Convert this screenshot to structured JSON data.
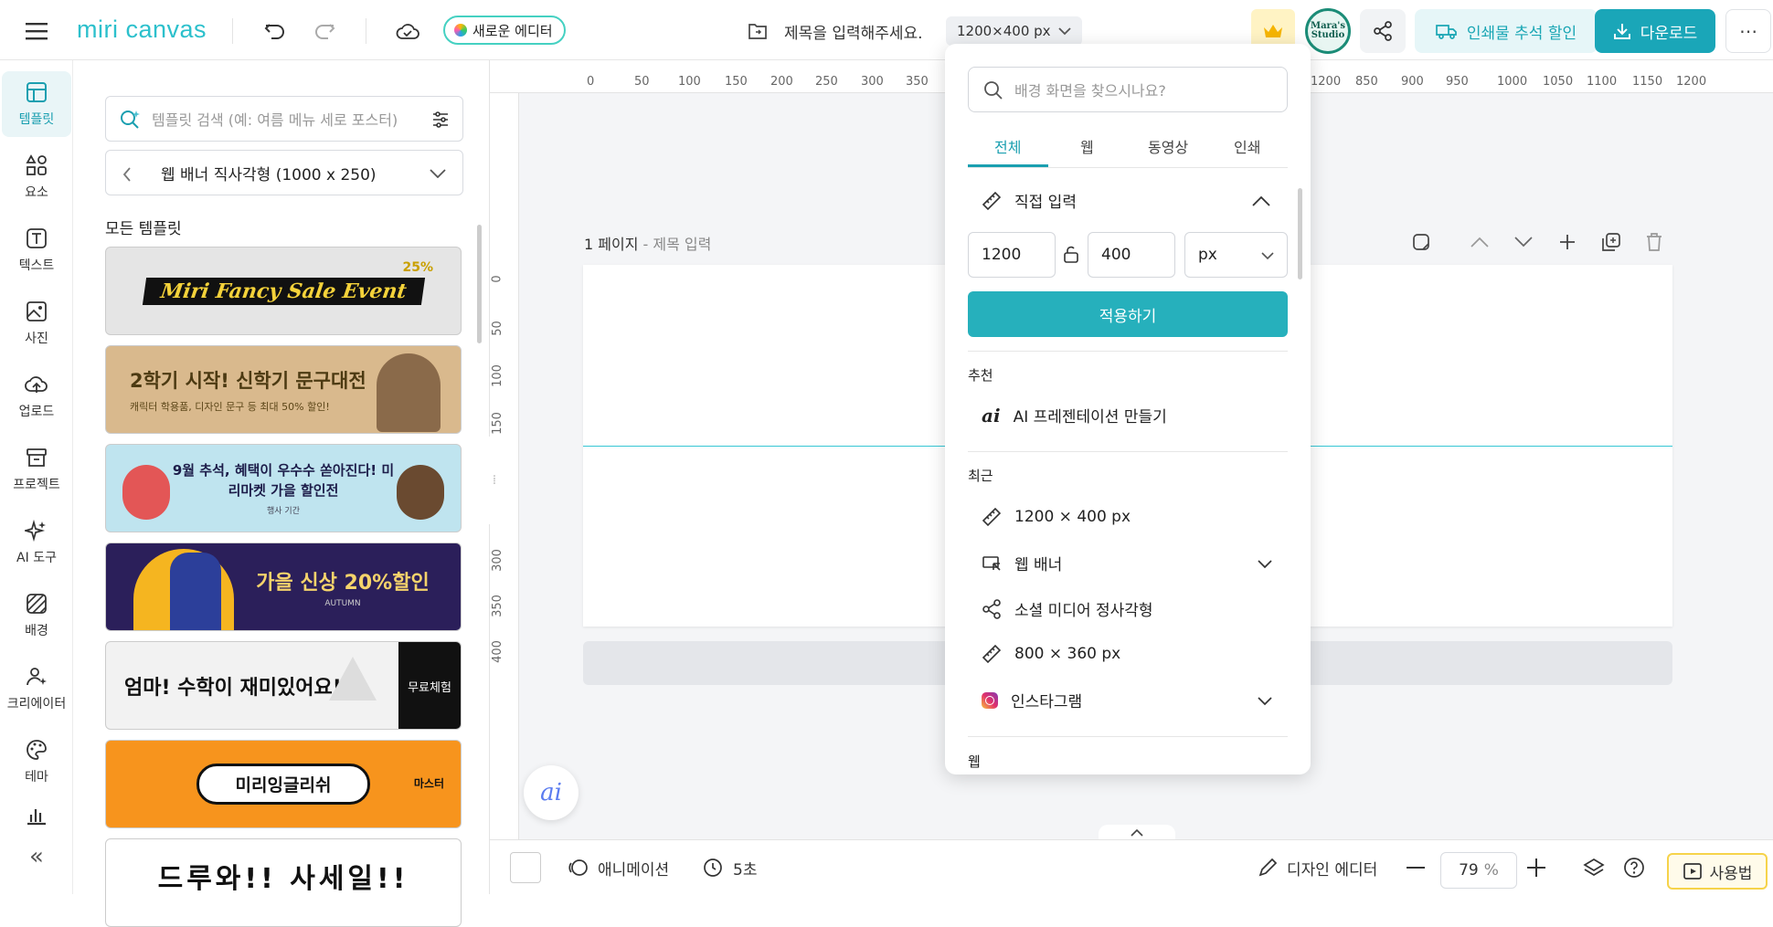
{
  "topbar": {
    "logo_text": "miri canvas",
    "new_editor_label": "새로운 에디터",
    "title_placeholder": "제목을 입력해주세요.",
    "size_label": "1200×400 px",
    "avatar_text": "Mara's Studio",
    "print_discount_label": "인쇄물 추석 할인",
    "download_label": "다운로드",
    "more_label": "⋯"
  },
  "leftnav": {
    "items": [
      {
        "label": "템플릿",
        "icon": "template-icon"
      },
      {
        "label": "요소",
        "icon": "elements-icon"
      },
      {
        "label": "텍스트",
        "icon": "text-icon"
      },
      {
        "label": "사진",
        "icon": "photo-icon"
      },
      {
        "label": "업로드",
        "icon": "upload-icon"
      },
      {
        "label": "프로젝트",
        "icon": "project-icon"
      },
      {
        "label": "AI 도구",
        "icon": "ai-tools-icon"
      },
      {
        "label": "배경",
        "icon": "background-icon"
      },
      {
        "label": "크리에이터",
        "icon": "creator-icon"
      },
      {
        "label": "테마",
        "icon": "theme-icon"
      }
    ],
    "collapse_label": "«"
  },
  "panel": {
    "search_placeholder": "템플릿 검색 (예: 여름 메뉴 세로 포스터)",
    "category": "웹 배너 직사각형 (1000 x 250)",
    "section_title": "모든 템플릿",
    "templates": [
      {
        "headline": "Miri Fancy Sale Event",
        "sub": "25%",
        "bg": "#e5e5e5",
        "fg": "#111111"
      },
      {
        "headline": "2학기 시작! 신학기 문구대전",
        "sub": "캐릭터 학용품, 디자인 문구 등 최대 50% 할인!",
        "bg": "#d9b98d",
        "fg": "#3a2a10"
      },
      {
        "headline": "9월 추석, 혜택이 우수수 쏟아진다! 미리마켓 가을 할인전",
        "sub": "행사 기간",
        "bg": "#bfe4ef",
        "fg": "#1d1d4a"
      },
      {
        "headline": "가을 신상 20%할인",
        "sub": "AUTUMN",
        "bg": "#2b1f5a",
        "fg": "#f5d36b"
      },
      {
        "headline": "엄마! 수학이 재미있어요!",
        "sub": "무료체험",
        "bg": "#f2f2f2",
        "fg": "#111111"
      },
      {
        "headline": "미리잉글리쉬",
        "sub": "마스터",
        "bg": "#f7941d",
        "fg": "#111111"
      },
      {
        "headline": "드루와!! 사세일!!",
        "sub": "",
        "bg": "#ffffff",
        "fg": "#111111"
      }
    ]
  },
  "ruler": {
    "top": [
      "0",
      "50",
      "100",
      "150",
      "200",
      "250",
      "300",
      "350",
      "1200",
      "850",
      "900",
      "950",
      "1000",
      "1050",
      "1100",
      "1150",
      "1200"
    ],
    "left": [
      "0",
      "50",
      "100",
      "150",
      "300",
      "350",
      "400"
    ]
  },
  "page": {
    "label": "1 페이지",
    "title_placeholder": "제목 입력"
  },
  "dropdown": {
    "search_placeholder": "배경 화면을 찾으시나요?",
    "tabs": [
      "전체",
      "웹",
      "동영상",
      "인쇄"
    ],
    "custom_label": "직접 입력",
    "width": "1200",
    "height": "400",
    "unit": "px",
    "apply_label": "적용하기",
    "recommend_title": "추천",
    "ai_presentation_label": "AI 프레젠테이션 만들기",
    "recent_title": "최근",
    "recent_items": [
      {
        "label": "1200 × 400 px",
        "icon": "ruler-icon",
        "expandable": false
      },
      {
        "label": "웹 배너",
        "icon": "web-banner-icon",
        "expandable": true
      },
      {
        "label": "소셜 미디어 정사각형",
        "icon": "share-icon",
        "expandable": false
      },
      {
        "label": "800 × 360 px",
        "icon": "ruler-icon",
        "expandable": false
      },
      {
        "label": "인스타그램",
        "icon": "instagram-icon",
        "expandable": true
      }
    ],
    "web_section_title": "웹"
  },
  "bottombar": {
    "animation_label": "애니메이션",
    "duration_label": "5초",
    "design_editor_label": "디자인 에디터",
    "zoom_value": "79",
    "zoom_unit": "%",
    "help_label": "사용법"
  },
  "colors": {
    "accent": "#1aa6b8",
    "accent_light": "#e6f6f8",
    "guide_line": "#36c6d4"
  }
}
